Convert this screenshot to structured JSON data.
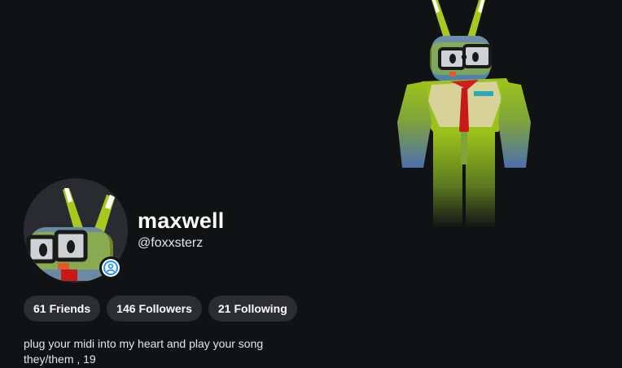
{
  "profile": {
    "display_name": "maxwell",
    "username": "@foxxsterz",
    "bio_lines": [
      "plug your midi into my heart and play your song",
      "they/them , 19"
    ]
  },
  "stats": [
    {
      "count": "61",
      "label": "Friends"
    },
    {
      "count": "146",
      "label": "Followers"
    },
    {
      "count": "21",
      "label": "Following"
    }
  ],
  "icons": {
    "presence": "person-icon"
  },
  "colors": {
    "background": "#111214",
    "pill": "#2c2d32",
    "presence_blue": "#1a8cff",
    "avatar_green": "#9cc21a",
    "tie_red": "#d01e1e"
  }
}
